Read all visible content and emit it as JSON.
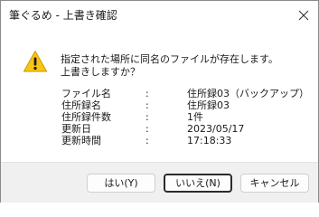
{
  "window": {
    "title": "筆ぐるめ - 上書き確認"
  },
  "icons": {
    "close": "close-icon",
    "warning": "warning-icon"
  },
  "colors": {
    "warning_fill": "#f9c413",
    "primary_button_border": "#2b2b2b",
    "footer_bg": "#f0f0f0"
  },
  "message": {
    "line1": "指定された場所に同名のファイルが存在します。",
    "line2": "上書きしますか？"
  },
  "details": [
    {
      "label": "ファイル名",
      "colon": ":",
      "value": "住所録03（バックアップ）"
    },
    {
      "label": "住所録名",
      "colon": ":",
      "value": "住所録03"
    },
    {
      "label": "住所録件数",
      "colon": ":",
      "value": "1件"
    },
    {
      "label": "更新日",
      "colon": ":",
      "value": "2023/05/17"
    },
    {
      "label": "更新時間",
      "colon": ":",
      "value": "17:18:33"
    }
  ],
  "buttons": {
    "yes": "はい(Y)",
    "no": "いいえ(N)",
    "cancel": "キャンセル"
  }
}
